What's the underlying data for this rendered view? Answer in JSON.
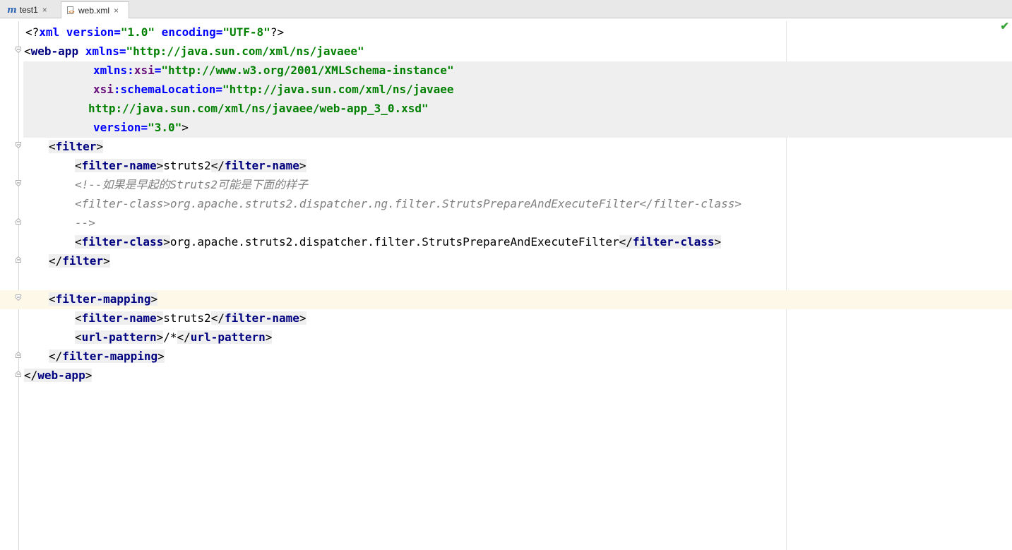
{
  "tabs": [
    {
      "label": "test1",
      "icon": "module-m-icon",
      "active": false
    },
    {
      "label": "web.xml",
      "icon": "xml-file-icon",
      "active": true
    }
  ],
  "editor": {
    "lines": {
      "l1_pi_open": "<?",
      "l1_xml": "xml",
      "l1_attr1": " version=",
      "l1_val1": "\"1.0\"",
      "l1_attr2": " encoding=",
      "l1_val2": "\"UTF-8\"",
      "l1_pi_close": "?>",
      "l2_lt": "<",
      "l2_tag": "web-app",
      "l2_attr": " xmlns=",
      "l2_val": "\"http://java.sun.com/xml/ns/javaee\"",
      "l3_ns": "xmlns",
      "l3_colon": ":",
      "l3_attr": "xsi",
      "l3_eq": "=",
      "l3_val": "\"http://www.w3.org/2001/XMLSchema-instance\"",
      "l4_ns": "xsi",
      "l4_colon": ":",
      "l4_attr": "schemaLocation",
      "l4_eq": "=",
      "l4_val": "\"http://java.sun.com/xml/ns/javaee",
      "l5_val": "http://java.sun.com/xml/ns/javaee/web-app_3_0.xsd\"",
      "l6_attr": "version",
      "l6_eq": "=",
      "l6_val": "\"3.0\"",
      "l6_gt": ">",
      "filter_tag": "filter",
      "filter_name_tag": "filter-name",
      "filter_name_value": "struts2",
      "comment_start": "<!--如果是早起的Struts2可能是下面的样子",
      "comment_code": "<filter-class>org.apache.struts2.dispatcher.ng.filter.StrutsPrepareAndExecuteFilter</filter-class>",
      "comment_end": "-->",
      "filter_class_tag": "filter-class",
      "filter_class_value": "org.apache.struts2.dispatcher.filter.StrutsPrepareAndExecuteFilter",
      "filter_mapping_tag": "filter-mapping",
      "url_pattern_tag": "url-pattern",
      "url_pattern_value": "/*",
      "root_close_tag": "web-app",
      "lt": "<",
      "gt": ">",
      "lt_slash": "</"
    }
  },
  "status": {
    "icon": "checkmark-icon",
    "glyph": "✔"
  },
  "colors": {
    "tag": "#000080",
    "attribute": "#0000ff",
    "namespace": "#660e7a",
    "value": "#008000",
    "comment": "#808080",
    "current_line": "#fdf8e7"
  }
}
